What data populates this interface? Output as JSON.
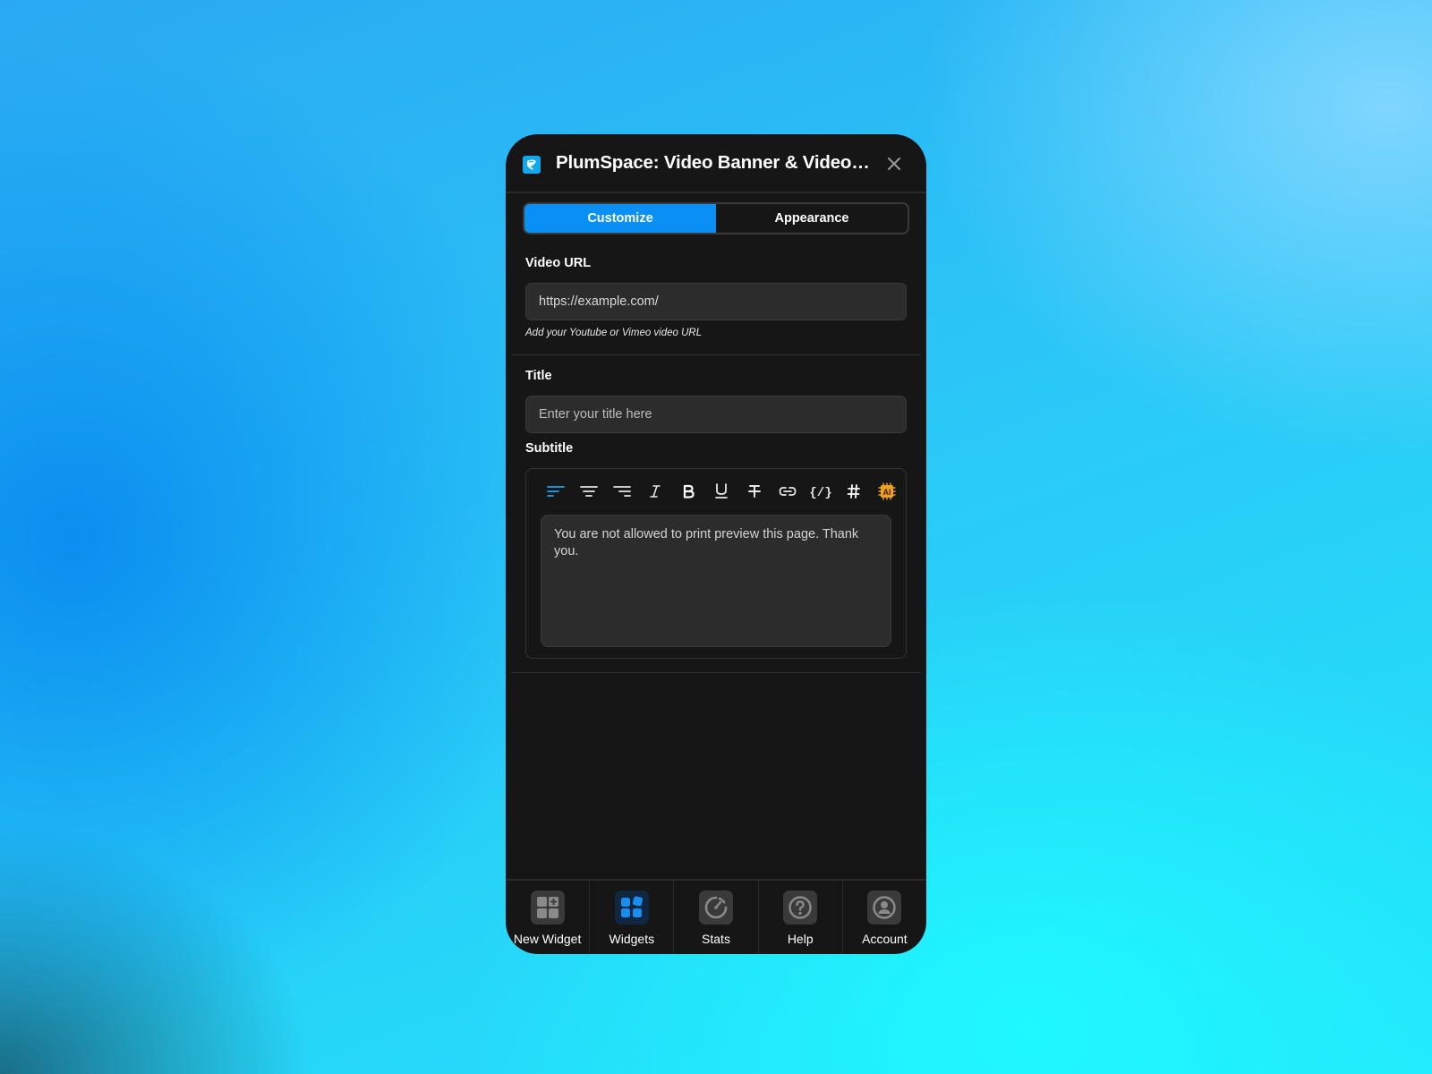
{
  "window": {
    "title": "PlumSpace: Video Banner & Video Player",
    "close_icon": "close-icon",
    "logo_icon": "plumspace-logo-icon"
  },
  "tabs": [
    {
      "label": "Customize",
      "active": true
    },
    {
      "label": "Appearance",
      "active": false
    }
  ],
  "form": {
    "video_url": {
      "label": "Video URL",
      "value": "https://example.com/",
      "hint": "Add your Youtube or Vimeo video URL"
    },
    "title_field": {
      "label": "Title",
      "value": "",
      "placeholder": "Enter your title here"
    },
    "subtitle": {
      "label": "Subtitle",
      "value": "You are not allowed to print preview this page. Thank you.",
      "toolbar": [
        {
          "name": "align-left-icon",
          "active": true
        },
        {
          "name": "align-center-icon"
        },
        {
          "name": "align-right-icon"
        },
        {
          "name": "italic-icon"
        },
        {
          "name": "bold-icon"
        },
        {
          "name": "underline-icon"
        },
        {
          "name": "strikethrough-icon"
        },
        {
          "name": "link-icon"
        },
        {
          "name": "code-icon"
        },
        {
          "name": "hashtag-icon"
        },
        {
          "name": "ai-icon"
        }
      ]
    }
  },
  "bottom_nav": [
    {
      "label": "New Widget",
      "icon": "new-widget-icon"
    },
    {
      "label": "Widgets",
      "icon": "widgets-icon",
      "active": true
    },
    {
      "label": "Stats",
      "icon": "stats-icon"
    },
    {
      "label": "Help",
      "icon": "help-icon"
    },
    {
      "label": "Account",
      "icon": "account-icon"
    }
  ],
  "colors": {
    "accent": "#0a90f5",
    "panel_bg": "#161616",
    "input_bg": "#2c2c2c",
    "ai_orange": "#f0a020"
  }
}
